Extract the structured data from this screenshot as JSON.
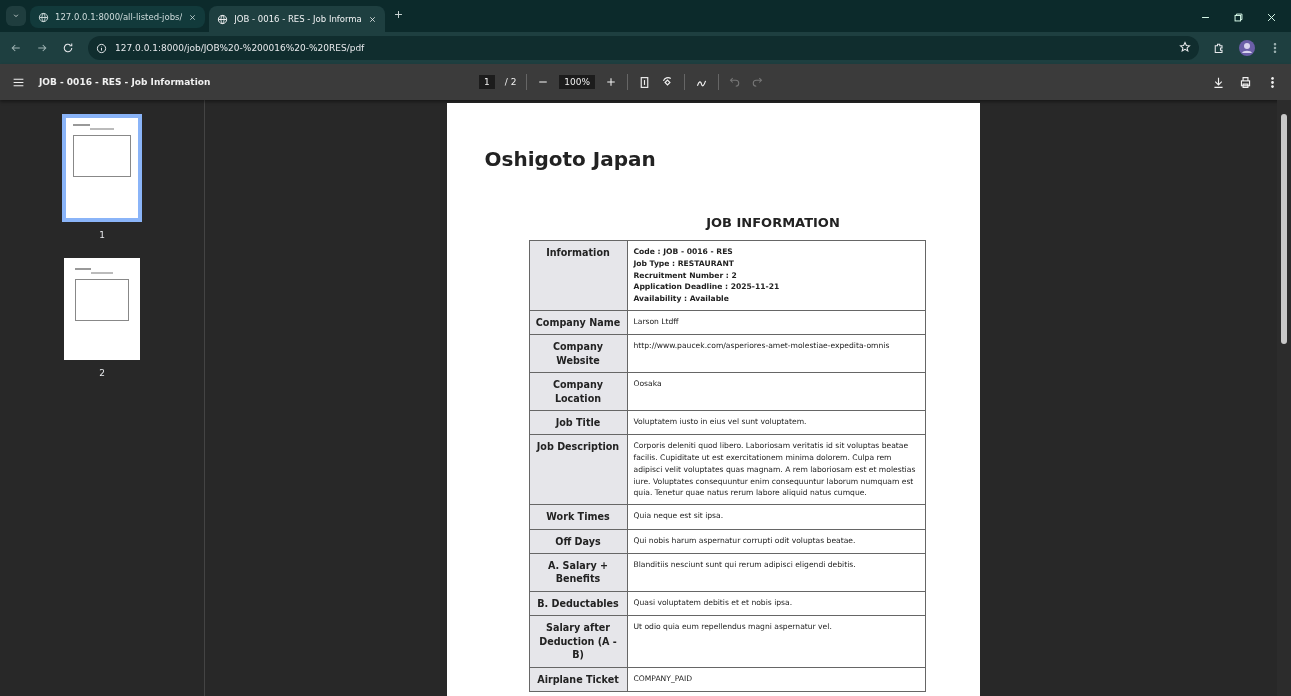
{
  "browser": {
    "tabs": [
      {
        "title": "127.0.0.1:8000/all-listed-jobs/",
        "selected": false
      },
      {
        "title": "JOB - 0016 - RES - Job Informa",
        "selected": true
      }
    ],
    "address": "127.0.0.1:8000/job/JOB%20-%200016%20-%20RES/pdf"
  },
  "viewer": {
    "title": "JOB - 0016 - RES - Job Information",
    "page": "1",
    "page_count": "/ 2",
    "zoom": "100%"
  },
  "thumbnails": [
    {
      "label": "1",
      "selected": true
    },
    {
      "label": "2",
      "selected": false
    }
  ],
  "document": {
    "company": "Oshigoto Japan",
    "heading": "JOB INFORMATION",
    "rows": [
      {
        "label": "Information",
        "kind": "list",
        "lines": [
          "Code : JOB - 0016 - RES",
          "Job Type : RESTAURANT",
          "Recruitment Number : 2",
          "Application Deadline : 2025-11-21",
          "Availability : Available"
        ]
      },
      {
        "label": "Company Name",
        "kind": "text",
        "value": "Larson Ltdff"
      },
      {
        "label": "Company Website",
        "kind": "text",
        "value": "http://www.paucek.com/asperiores-amet-molestiae-expedita-omnis"
      },
      {
        "label": "Company Location",
        "kind": "text",
        "value": "Oosaka"
      },
      {
        "label": "Job Title",
        "kind": "text",
        "value": "Voluptatem iusto in eius vel sunt voluptatem."
      },
      {
        "label": "Job Description",
        "kind": "text",
        "value": "Corporis deleniti quod libero. Laboriosam veritatis id sit voluptas beatae facilis. Cupiditate ut est exercitationem minima dolorem. Culpa rem adipisci velit voluptates quas magnam. A rem laboriosam est et molestias iure. Voluptates consequuntur enim consequuntur laborum numquam est quia. Tenetur quae natus rerum labore aliquid natus cumque."
      },
      {
        "label": "Work Times",
        "kind": "text",
        "value": "Quia neque est sit ipsa."
      },
      {
        "label": "Off Days",
        "kind": "text",
        "value": "Qui nobis harum aspernatur corrupti odit voluptas beatae."
      },
      {
        "label": "A. Salary + Benefits",
        "kind": "text",
        "value": "Blanditiis nesciunt sunt qui rerum adipisci eligendi debitis."
      },
      {
        "label": "B. Deductables",
        "kind": "text",
        "value": "Quasi voluptatem debitis et et nobis ipsa."
      },
      {
        "label": "Salary after Deduction (A - B)",
        "kind": "text",
        "value": "Ut odio quia eum repellendus magni aspernatur vel."
      },
      {
        "label": "Airplane Ticket",
        "kind": "text",
        "value": "COMPANY_PAID"
      }
    ]
  }
}
